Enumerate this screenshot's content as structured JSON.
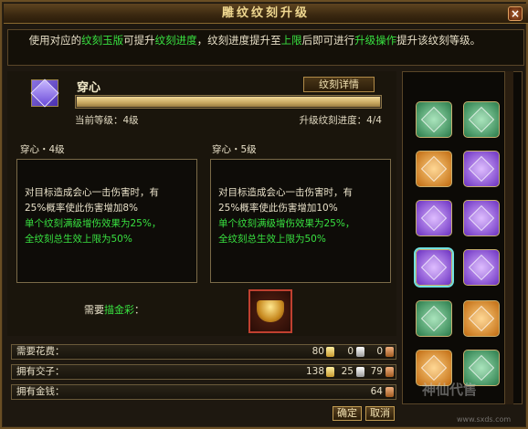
{
  "window": {
    "title": "雕纹纹刻升级",
    "close_label": "×"
  },
  "intro": {
    "p1": "使用对应的",
    "g1": "纹刻玉版",
    "p2": "可提升",
    "g2": "纹刻进度",
    "p3": "，纹刻进度提升至",
    "g3": "上限",
    "p4": "后即可进行",
    "g4": "升级操作",
    "p5": "提升该纹刻等级。"
  },
  "skill": {
    "name": "穿心",
    "detail_button": "纹刻详情",
    "current_level_label": "当前等级：4级",
    "progress_label": "升级纹刻进度：4/4",
    "progress_fraction": 1.0
  },
  "current": {
    "title": "穿心・4级",
    "line1": "对目标造成会心一击伤害时，有",
    "line2": "25%概率使此伤害增加8%",
    "green1": "单个纹刻满级增伤效果为25%，",
    "green2": "全纹刻总生效上限为50%"
  },
  "next": {
    "title": "穿心・5级",
    "line1": "对目标造成会心一击伤害时，有",
    "line2": "25%概率使此伤害增加10%",
    "green1": "单个纹刻满级增伤效果为25%，",
    "green2": "全纹刻总生效上限为50%"
  },
  "need": {
    "prefix": "需要",
    "item": "描金彩",
    "suffix": "："
  },
  "costs": [
    {
      "label": "需要花费：",
      "gold": "80",
      "silver": "0",
      "copper": "0"
    },
    {
      "label": "拥有交子：",
      "gold": "138",
      "silver": "25",
      "copper": "79"
    },
    {
      "label": "拥有金钱：",
      "gold": "",
      "silver": "",
      "copper": "64"
    }
  ],
  "buttons": {
    "confirm": "确定",
    "cancel": "取消"
  },
  "runes": [
    {
      "color": "green",
      "icon": "green-rune-icon"
    },
    {
      "color": "green",
      "icon": "green-rune-icon"
    },
    {
      "color": "orange",
      "icon": "orange-rune-icon"
    },
    {
      "color": "purple",
      "icon": "purple-rune-icon"
    },
    {
      "color": "purple",
      "icon": "purple-rune-icon"
    },
    {
      "color": "purple",
      "icon": "purple-rune-icon"
    },
    {
      "color": "purple",
      "icon": "purple-rune-icon",
      "selected": true
    },
    {
      "color": "purple",
      "icon": "purple-rune-icon"
    },
    {
      "color": "green",
      "icon": "green-rune-icon"
    },
    {
      "color": "orange",
      "icon": "orange-rune-icon"
    },
    {
      "color": "orange",
      "icon": "orange-rune-icon"
    },
    {
      "color": "green",
      "icon": "green-rune-icon"
    }
  ],
  "watermark": {
    "logo": "神仙代售",
    "url": "www.sxds.com"
  }
}
